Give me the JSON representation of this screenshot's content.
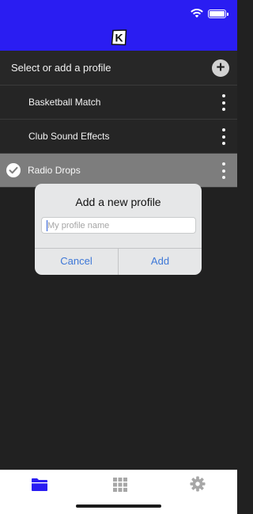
{
  "status_bar": {
    "wifi_icon": "wifi-icon",
    "battery_icon": "battery-icon"
  },
  "header": {
    "logo_letter": "K",
    "background": "#2a1df2"
  },
  "profiles": {
    "title": "Select or add a profile",
    "add_icon": "plus-circle-icon",
    "items": [
      {
        "label": "Basketball Match",
        "selected": false
      },
      {
        "label": "Club Sound Effects",
        "selected": false
      },
      {
        "label": "Radio Drops",
        "selected": true
      }
    ]
  },
  "dialog": {
    "title": "Add a new profile",
    "input_value": "",
    "input_placeholder": "My profile name",
    "cancel_label": "Cancel",
    "add_label": "Add"
  },
  "tabbar": {
    "tabs": [
      {
        "icon": "folder-icon",
        "active": true
      },
      {
        "icon": "grid-icon",
        "active": false
      },
      {
        "icon": "gear-icon",
        "active": false
      }
    ],
    "active_color": "#2a1df2",
    "inactive_color": "#a7a7a7"
  }
}
